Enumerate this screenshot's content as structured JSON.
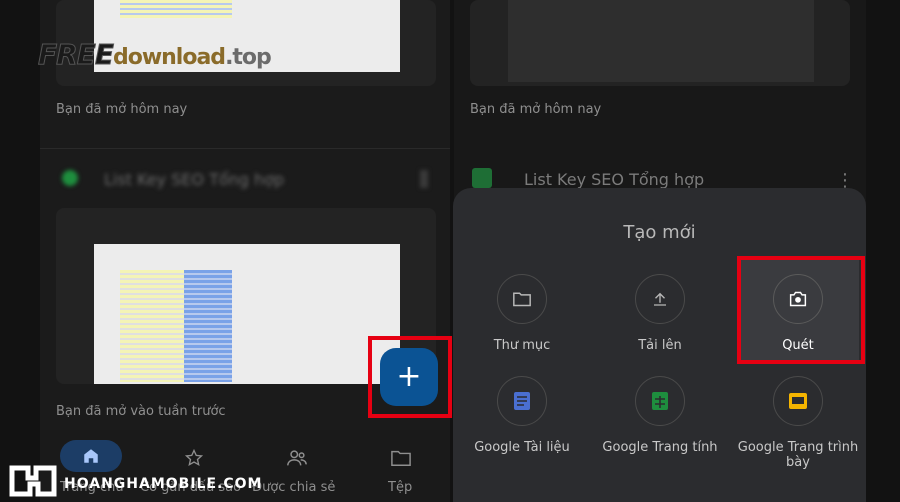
{
  "watermark": {
    "free": "FREE",
    "download": "download",
    "top": ".top"
  },
  "left_column": {
    "card1_caption": "Bạn đã mở hôm nay",
    "card2_title_blurred": "List Key SEO Tổng hợp",
    "card2_caption": "Bạn đã mở vào tuần trước"
  },
  "right_column": {
    "card1_caption": "Bạn đã mở hôm nay",
    "card2_title": "List Key SEO Tổng hợp"
  },
  "create_sheet": {
    "title": "Tạo mới",
    "items": [
      {
        "label": "Thư mục",
        "icon": "folder-icon"
      },
      {
        "label": "Tải lên",
        "icon": "upload-icon"
      },
      {
        "label": "Quét",
        "icon": "camera-icon"
      },
      {
        "label": "Google Tài liệu",
        "icon": "docs-icon"
      },
      {
        "label": "Google Trang tính",
        "icon": "sheets-icon"
      },
      {
        "label": "Google Trang trình bày",
        "icon": "slides-icon"
      }
    ]
  },
  "fab": {
    "label": "+"
  },
  "bottom_nav": {
    "home": "Trang chủ",
    "starred": "Có gắn dấu sao",
    "shared": "Được chia sẻ",
    "files": "Tệp"
  },
  "brand": {
    "text": "HOANGHAMOBILE.COM"
  },
  "colors": {
    "highlight_red": "#e60012",
    "fab_blue": "#0b5394",
    "sheets_green": "#1e8e3e",
    "docs_blue": "#4a6fd1",
    "slides_yellow": "#f4b400"
  }
}
